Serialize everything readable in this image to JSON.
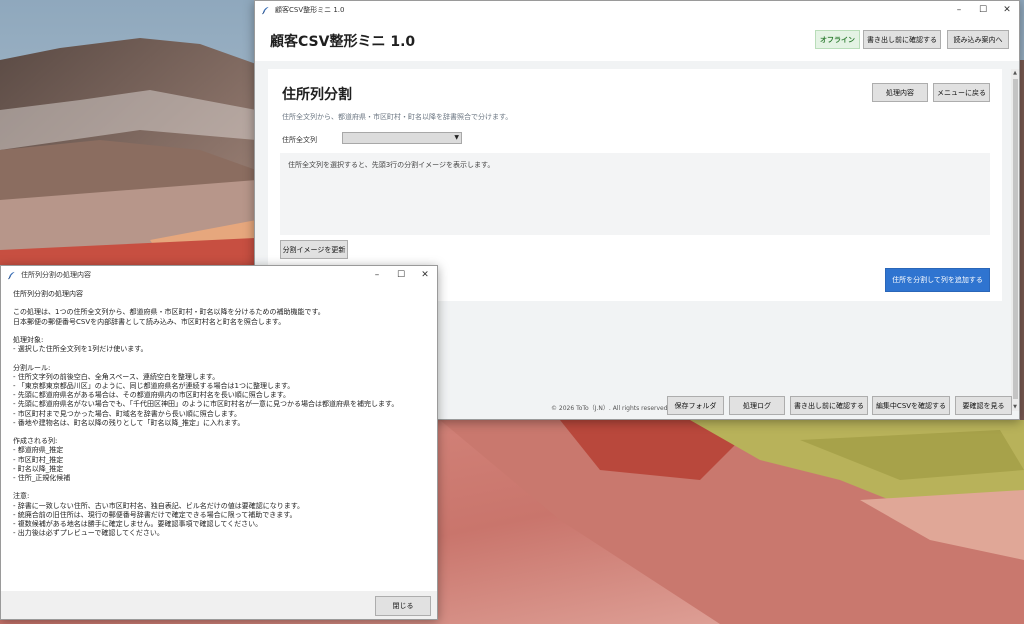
{
  "main_window": {
    "title": "顧客CSV整形ミニ 1.0",
    "controls": {
      "minimize": "–",
      "maximize": "☐",
      "close": "✕"
    },
    "header": {
      "app_title": "顧客CSV整形ミニ 1.0",
      "status": "オフライン",
      "check_before_export": "書き出し前に確認する",
      "import_guide": "読み込み案内へ"
    },
    "panel": {
      "title": "住所列分割",
      "description": "住所全文列から、都道府県・市区町村・町名以降を辞書照合で分けます。",
      "process_details_button": "処理内容",
      "back_to_menu_button": "メニューに戻る",
      "field_label": "住所全文列",
      "select_value": "",
      "preview_placeholder": "住所全文列を選択すると、先頭3行の分割イメージを表示します。",
      "update_preview_button": "分割イメージを更新",
      "split_button": "住所を分割して列を追加する"
    },
    "footer": {
      "copyright": "© 2026 ToTo（J.N）. All rights reserved.",
      "buttons": [
        "保存フォルダ",
        "処理ログ",
        "書き出し前に確認する",
        "編集中CSVを確認する",
        "要確認を見る"
      ]
    }
  },
  "dialog": {
    "title": "住所列分割の処理内容",
    "controls": {
      "minimize": "–",
      "maximize": "☐",
      "close": "✕"
    },
    "content": "住所列分割の処理内容\n\nこの処理は、1つの住所全文列から、都道府県・市区町村・町名以降を分けるための補助機能です。\n日本郵便の郵便番号CSVを内部辞書として読み込み、市区町村名と町名を照合します。\n\n処理対象:\n- 選択した住所全文列を1列だけ使います。\n\n分割ルール:\n- 住所文字列の前後空白、全角スペース、連続空白を整理します。\n- 「東京都東京都品川区」のように、同じ都道府県名が連続する場合は1つに整理します。\n- 先頭に都道府県名がある場合は、その都道府県内の市区町村名を長い順に照合します。\n- 先頭に都道府県名がない場合でも、「千代田区神田」のように市区町村名が一意に見つかる場合は都道府県を補完します。\n- 市区町村まで見つかった場合、町域名を辞書から長い順に照合します。\n- 番地や建物名は、町名以降の残りとして「町名以降_推定」に入れます。\n\n作成される列:\n- 都道府県_推定\n- 市区町村_推定\n- 町名以降_推定\n- 住所_正規化候補\n\n注意:\n- 辞書に一致しない住所、古い市区町村名、独自表記、ビル名だけの値は要確認になります。\n- 統廃合前の旧住所は、現行の郵便番号辞書だけで確定できる場合に限って補助できます。\n- 複数候補がある地名は勝手に確定しません。要確認事項で確認してください。\n- 出力後は必ずプレビューで確認してください。",
    "close_button": "閉じる"
  },
  "icons": {
    "app_icon": "feather-icon"
  },
  "colors": {
    "primary": "#2f74d0",
    "status_online": "#2e7d32"
  }
}
